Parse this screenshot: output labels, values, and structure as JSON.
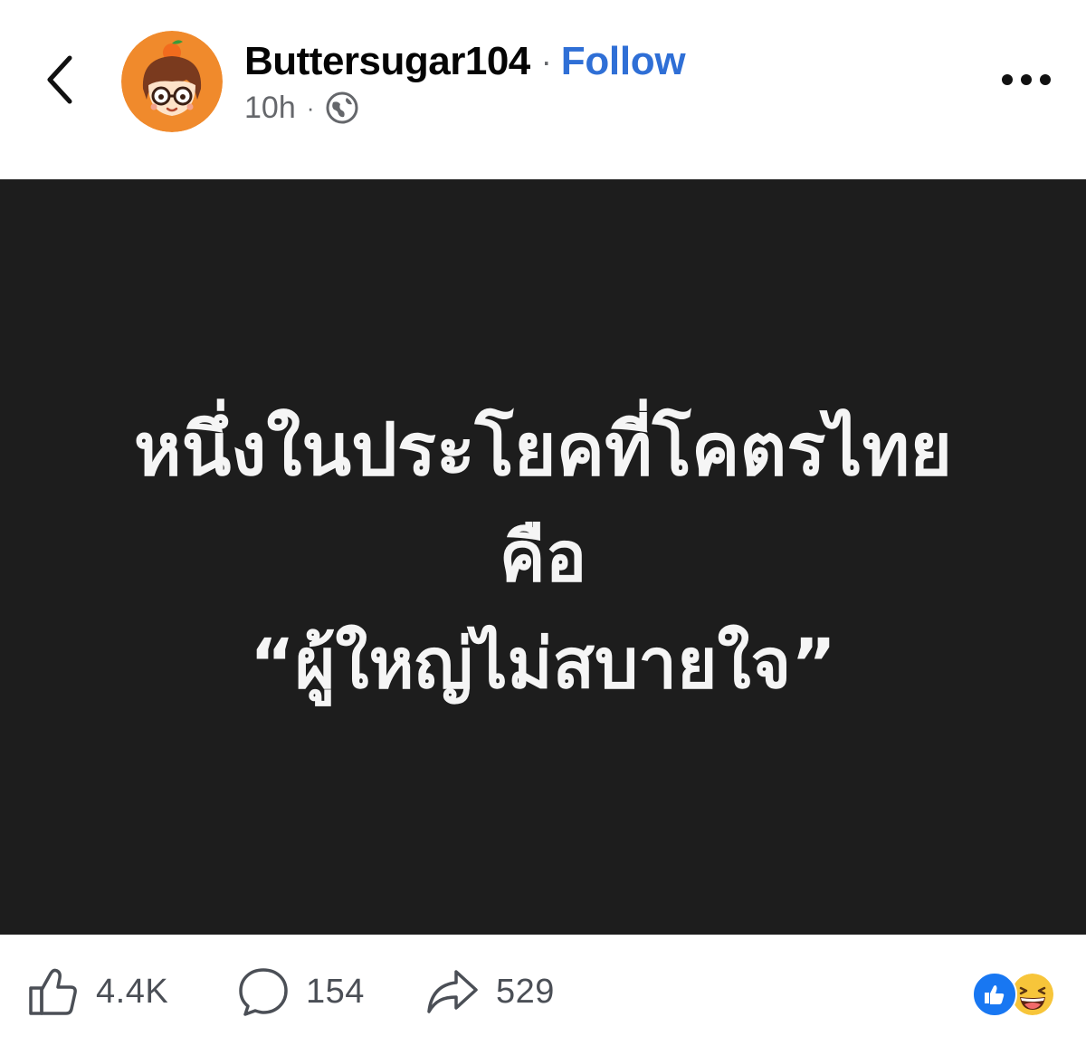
{
  "header": {
    "author_name": "Buttersugar104",
    "separator": "·",
    "follow_label": "Follow",
    "timestamp": "10h",
    "meta_separator": "·",
    "privacy_icon": "globe-icon",
    "back_icon": "chevron-left-icon",
    "more_icon": "more-horizontal-icon"
  },
  "post": {
    "lines": [
      "หนึ่งในประโยคที่โคตรไทย",
      "คือ",
      "“ผู้ใหญ่ไม่สบายใจ”"
    ],
    "background_color": "#1d1d1d",
    "text_color": "#f5f5f5"
  },
  "actions": {
    "like_count": "4.4K",
    "comment_count": "154",
    "share_count": "529",
    "like_icon": "thumbs-up-icon",
    "comment_icon": "comment-bubble-icon",
    "share_icon": "share-arrow-icon"
  },
  "reactions": {
    "icons": [
      "like-reaction-icon",
      "haha-reaction-icon"
    ]
  },
  "colors": {
    "follow_blue": "#2f6fd6",
    "like_blue": "#1877f2",
    "meta_gray": "#65676b",
    "avatar_orange": "#f08a2c"
  }
}
